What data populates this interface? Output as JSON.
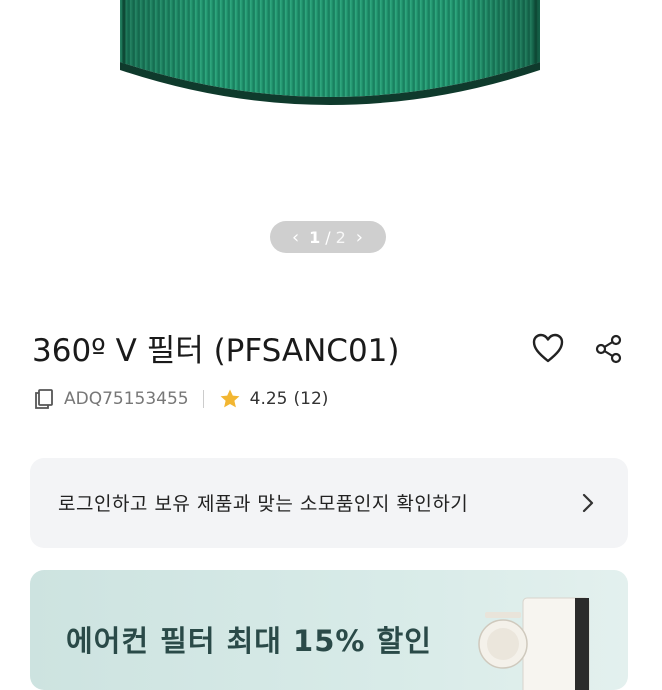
{
  "gallery": {
    "current": "1",
    "separator": "/",
    "total": "2",
    "prev_icon": "chevron-left-icon",
    "next_icon": "chevron-right-icon"
  },
  "product": {
    "title": "360º V 필터 (PFSANC01)",
    "model_code": "ADQ75153455",
    "rating": "4.25",
    "review_count": "(12)",
    "wishlist_icon": "heart-icon",
    "share_icon": "share-icon"
  },
  "login_banner": {
    "text": "로그인하고 보유 제품과 맞는 소모품인지 확인하기"
  },
  "promo_banner": {
    "text": "에어컨 필터 최대 15% 할인"
  },
  "colors": {
    "filter_green": "#1f8f6a",
    "pager_bg": "#cfcfcf",
    "star": "#f2b632",
    "card_bg": "#f3f4f6",
    "promo_bg": "#d3e7e4"
  }
}
